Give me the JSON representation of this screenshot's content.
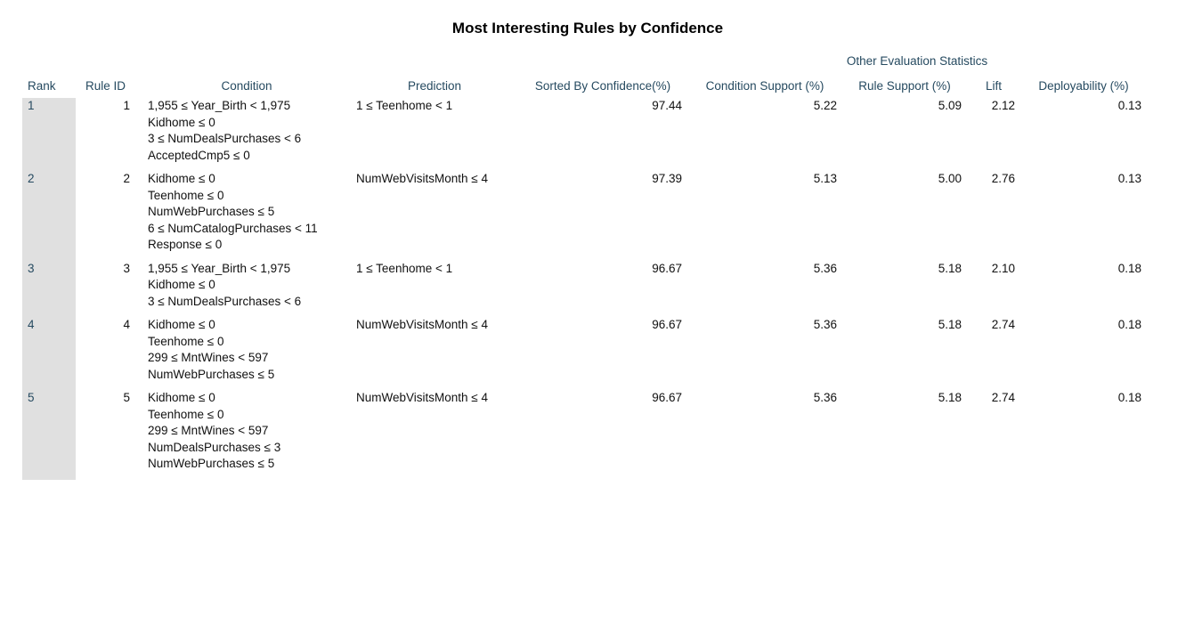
{
  "title": "Most Interesting Rules by Confidence",
  "group_header": "Other Evaluation Statistics",
  "columns": {
    "rank": "Rank",
    "rule_id": "Rule ID",
    "condition": "Condition",
    "prediction": "Prediction",
    "confidence": "Sorted By Confidence(%)",
    "condition_support": "Condition Support (%)",
    "rule_support": "Rule Support (%)",
    "lift": "Lift",
    "deployability": "Deployability (%)"
  },
  "rows": [
    {
      "rank": "1",
      "rule_id": "1",
      "condition": [
        "1,955 ≤ Year_Birth < 1,975",
        "Kidhome ≤ 0",
        "3 ≤ NumDealsPurchases < 6",
        "AcceptedCmp5 ≤ 0"
      ],
      "prediction": "1 ≤ Teenhome < 1",
      "confidence": "97.44",
      "condition_support": "5.22",
      "rule_support": "5.09",
      "lift": "2.12",
      "deployability": "0.13"
    },
    {
      "rank": "2",
      "rule_id": "2",
      "condition": [
        "Kidhome ≤ 0",
        "Teenhome ≤ 0",
        "NumWebPurchases ≤ 5",
        "6 ≤ NumCatalogPurchases < 11",
        "Response ≤ 0"
      ],
      "prediction": "NumWebVisitsMonth ≤ 4",
      "confidence": "97.39",
      "condition_support": "5.13",
      "rule_support": "5.00",
      "lift": "2.76",
      "deployability": "0.13"
    },
    {
      "rank": "3",
      "rule_id": "3",
      "condition": [
        "1,955 ≤ Year_Birth < 1,975",
        "Kidhome ≤ 0",
        "3 ≤ NumDealsPurchases < 6"
      ],
      "prediction": "1 ≤ Teenhome < 1",
      "confidence": "96.67",
      "condition_support": "5.36",
      "rule_support": "5.18",
      "lift": "2.10",
      "deployability": "0.18"
    },
    {
      "rank": "4",
      "rule_id": "4",
      "condition": [
        "Kidhome ≤ 0",
        "Teenhome ≤ 0",
        "299 ≤ MntWines < 597",
        "NumWebPurchases ≤ 5"
      ],
      "prediction": "NumWebVisitsMonth ≤ 4",
      "confidence": "96.67",
      "condition_support": "5.36",
      "rule_support": "5.18",
      "lift": "2.74",
      "deployability": "0.18"
    },
    {
      "rank": "5",
      "rule_id": "5",
      "condition": [
        "Kidhome ≤ 0",
        "Teenhome ≤ 0",
        "299 ≤ MntWines < 597",
        "NumDealsPurchases ≤ 3",
        "NumWebPurchases ≤ 5"
      ],
      "prediction": "NumWebVisitsMonth ≤ 4",
      "confidence": "96.67",
      "condition_support": "5.36",
      "rule_support": "5.18",
      "lift": "2.74",
      "deployability": "0.18"
    }
  ]
}
